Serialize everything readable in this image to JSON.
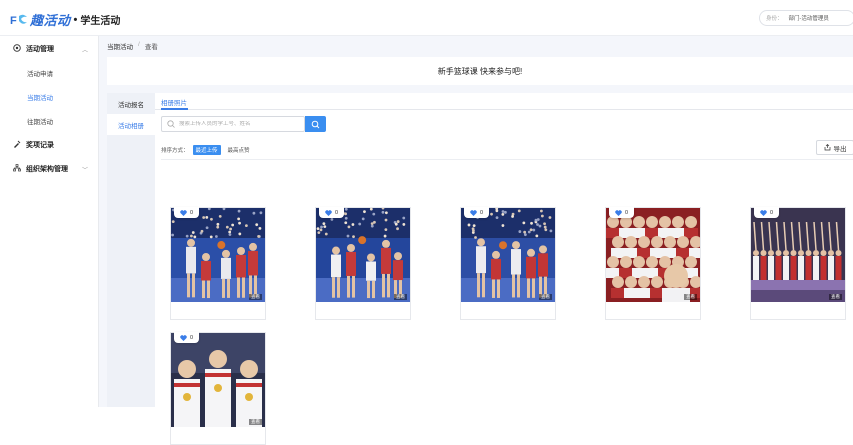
{
  "header": {
    "brand": "趣活动",
    "dot": "•",
    "subtitle": "学生活动",
    "identity_label": "身份：",
    "identity_value": "部门-活动管理员"
  },
  "sidebar": {
    "groups": [
      {
        "label": "活动管理",
        "icon": "activity-icon",
        "expanded": true,
        "items": [
          {
            "label": "活动申请",
            "active": false
          },
          {
            "label": "当期活动",
            "active": true
          },
          {
            "label": "往期活动",
            "active": false
          }
        ]
      },
      {
        "label": "奖项记录",
        "icon": "award-icon",
        "expanded": false
      },
      {
        "label": "组织架构管理",
        "icon": "org-icon",
        "expanded": false
      }
    ]
  },
  "breadcrumb": {
    "parent": "当期活动",
    "separator": "/",
    "current": "查看"
  },
  "banner": {
    "title": "新手篮球课 快来参与吧!"
  },
  "leftnav": {
    "tabs": [
      {
        "label": "活动报名",
        "active": false
      },
      {
        "label": "活动相册",
        "active": true
      }
    ]
  },
  "panel": {
    "tab": "相册照片",
    "search_placeholder": "搜索上传人员的学工号、姓名",
    "sort_label": "排序方式：",
    "sort_options": [
      {
        "label": "最近上传",
        "active": true
      },
      {
        "label": "最高点赞",
        "active": false
      }
    ],
    "export_label": "导出",
    "photos": [
      {
        "likes": "0",
        "view": "查看",
        "scene": "game",
        "colors": [
          "#2b4fa8",
          "#c43a3a",
          "#e9e9ee"
        ]
      },
      {
        "likes": "0",
        "view": "查看",
        "scene": "game",
        "colors": [
          "#24469c",
          "#c43a3a",
          "#f0f0f2"
        ]
      },
      {
        "likes": "0",
        "view": "查看",
        "scene": "game",
        "colors": [
          "#2d4ea5",
          "#c23636",
          "#ececf0"
        ]
      },
      {
        "likes": "0",
        "view": "查看",
        "scene": "crowd",
        "colors": [
          "#b63030",
          "#f3f3f5",
          "#d9a68a"
        ]
      },
      {
        "likes": "0",
        "view": "查看",
        "scene": "podium",
        "colors": [
          "#3a3450",
          "#c22f2f",
          "#8b73b0"
        ]
      },
      {
        "likes": "0",
        "view": "查看",
        "scene": "medal",
        "colors": [
          "#2a2f4a",
          "#ffffff",
          "#c23333"
        ]
      }
    ]
  }
}
